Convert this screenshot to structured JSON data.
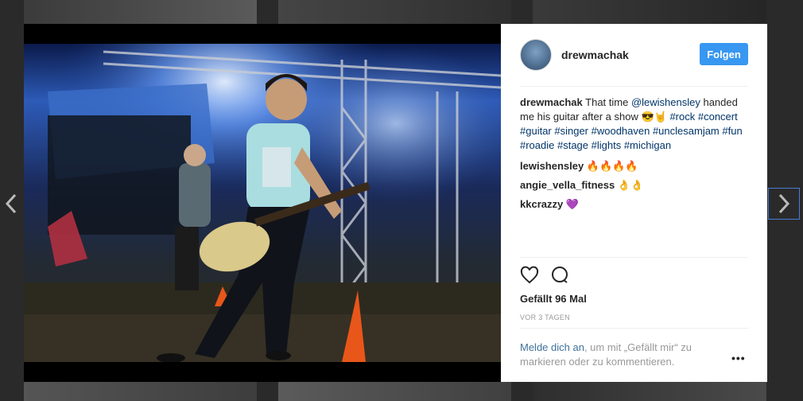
{
  "post": {
    "username": "drewmachak",
    "follow_label": "Folgen",
    "caption": {
      "user": "drewmachak",
      "text_before": "That time ",
      "mention": "@lewishensley",
      "text_after": " handed me his guitar after a show 😎🤘 ",
      "hashtags": "#rock #concert #guitar #singer #woodhaven #unclesamjam #fun #roadie #stage #lights #michigan"
    },
    "comments": [
      {
        "user": "lewishensley",
        "text": "🔥🔥🔥🔥"
      },
      {
        "user": "angie_vella_fitness",
        "text": "👌👌"
      },
      {
        "user": "kkcrazzy",
        "text": "💜"
      }
    ],
    "likes": "Gefällt 96 Mal",
    "time": "VOR 3 TAGEN",
    "login_link": "Melde dich an",
    "login_rest": ", um mit „Gefällt mir“ zu markieren oder zu kommentieren.",
    "more_label": "•••"
  },
  "icons": [
    "heart-icon",
    "comment-icon",
    "chevron-left-icon",
    "chevron-right-icon"
  ],
  "colors": {
    "follow_button": "#3897f0",
    "link": "#003569",
    "muted": "#999999"
  }
}
